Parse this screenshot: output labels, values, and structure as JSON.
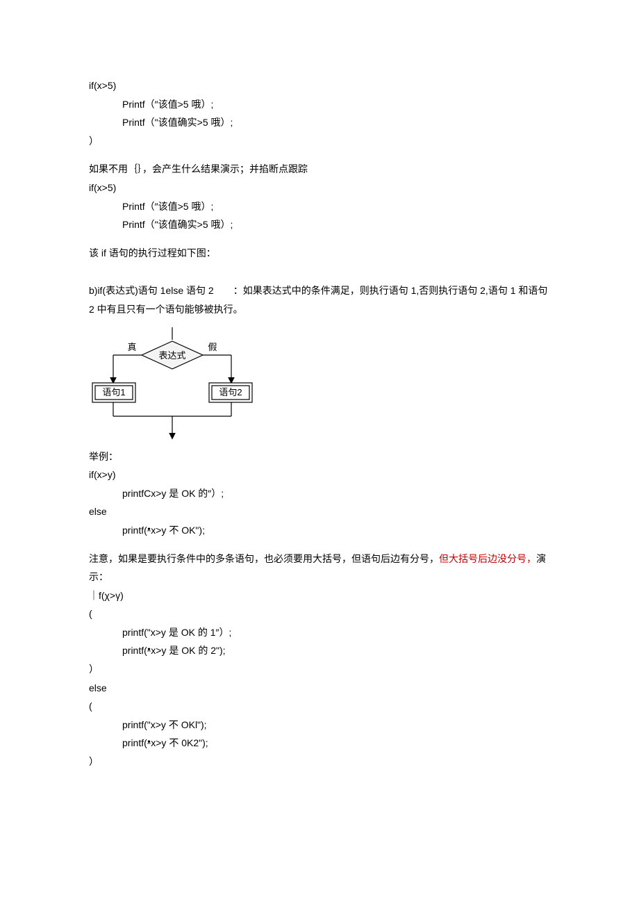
{
  "block1": {
    "l1": "if(x>5)",
    "l2": "Printf（″该值>5 哦）;",
    "l3": "Printf（\"该值确实>5 哦）;",
    "l4": "）"
  },
  "para1": "如果不用｛｝，会产生什么结果演示；并掐断点跟踪",
  "block2": {
    "l1": "if(x>5)",
    "l2": "Printf（″该值>5 哦）;",
    "l3": "Printf（\"该值确实>5 哦）;"
  },
  "para2": "该 if 语句的执行过程如下图：",
  "para3": "b)if(表达式)语句 1else 语句 2  ：如果表达式中的条件满足，则执行语句 1,否则执行语句 2,语句 1 和语句 2 中有且只有一个语句能够被执行。",
  "flow": {
    "true": "真",
    "false": "假",
    "cond": "表达式",
    "s1": "语句1",
    "s2": "语句2"
  },
  "para4": "举例：",
  "block3": {
    "l1": "if(x>y)",
    "l2": "printfCx>y 是 OK 的″）;",
    "l3": "else",
    "l4": "printf(ᵜx>y 不 OK\");"
  },
  "para5a": "注意，如果是要执行条件中的多条语句，也必须要用大括号，但语句后边有分号，",
  "para5b": "但大括号后边没分号，",
  "para5c": "演示：",
  "block4": {
    "l1": "｜f(χ>γ)",
    "l2": "(",
    "l3": "printf(\"x>y 是 OK 的 1″）;",
    "l4": "printf(ᵜx>y 是 OK 的 2\");",
    "l5": "）",
    "l6": "else",
    "l7": "(",
    "l8": "printf(\"x>y 不 OKl\");",
    "l9": "printf(ᵜx>y 不 0K2\");",
    "l10": "）"
  }
}
